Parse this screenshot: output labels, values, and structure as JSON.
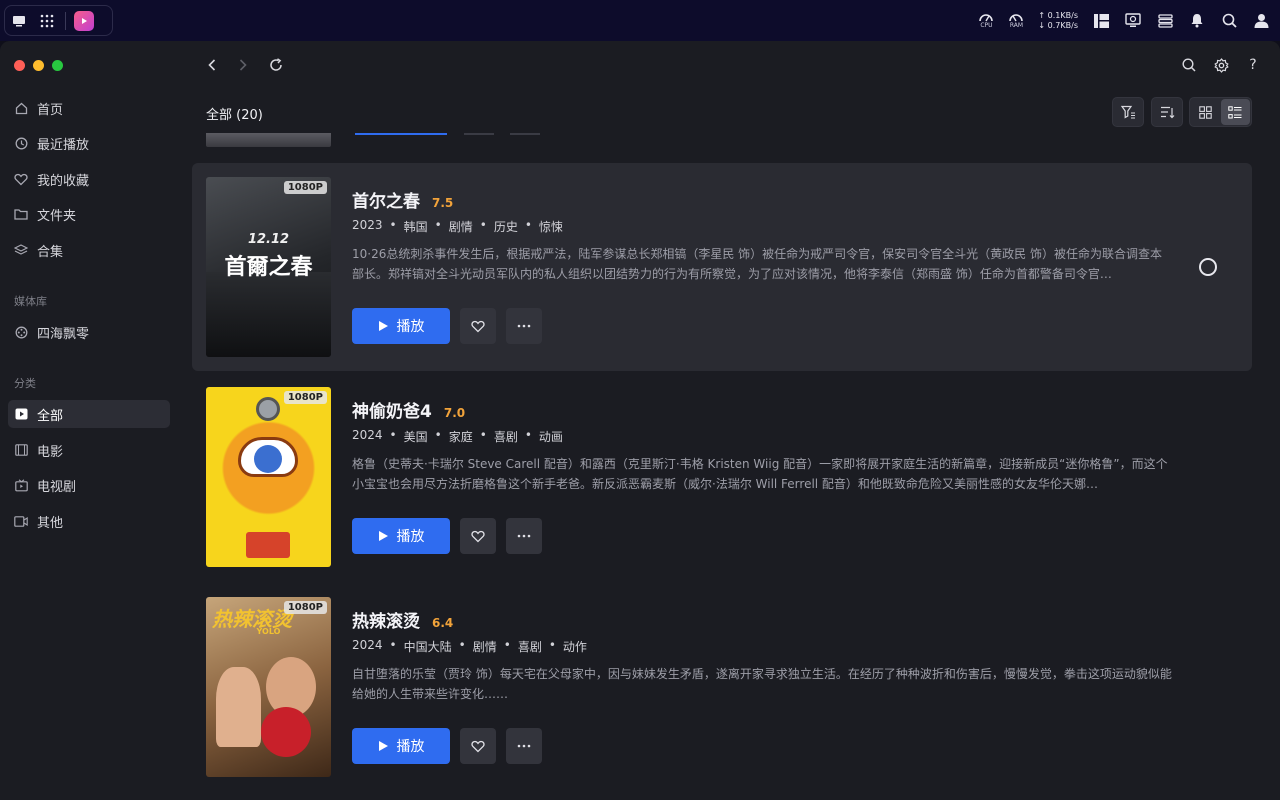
{
  "sysbar": {
    "cpu_label": "CPU",
    "ram_label": "RAM",
    "upload": "0.1KB/s",
    "download": "0.7KB/s"
  },
  "sidebar": {
    "items": [
      {
        "label": "首页",
        "icon": "home-icon"
      },
      {
        "label": "最近播放",
        "icon": "clock-icon"
      },
      {
        "label": "我的收藏",
        "icon": "heart-icon"
      },
      {
        "label": "文件夹",
        "icon": "folder-icon"
      },
      {
        "label": "合集",
        "icon": "layers-icon"
      }
    ],
    "library_section": "媒体库",
    "library_items": [
      {
        "label": "四海飘零",
        "icon": "film-reel-icon"
      }
    ],
    "category_section": "分类",
    "category_items": [
      {
        "label": "全部",
        "icon": "play-square-icon",
        "active": true
      },
      {
        "label": "电影",
        "icon": "film-icon"
      },
      {
        "label": "电视剧",
        "icon": "tv-icon"
      },
      {
        "label": "其他",
        "icon": "video-icon"
      }
    ]
  },
  "main": {
    "count_title": "全部 (20)",
    "play_label": "播放",
    "items": [
      {
        "title": "首尔之春",
        "score": "7.5",
        "badge": "1080P",
        "meta": [
          "2023",
          "韩国",
          "剧情",
          "历史",
          "惊悚"
        ],
        "description": "10·26总统刺杀事件发生后，根据戒严法，陆军参谋总长郑相镐（李星民 饰）被任命为戒严司令官，保安司令官全斗光（黄政民 饰）被任命为联合调查本部长。郑祥镐对全斗光动员军队内的私人组织以团结势力的行为有所察觉，为了应对该情况，他将李泰信（郑雨盛 饰）任命为首都警备司令官…",
        "poster_text": "首爾之春",
        "poster_sub": "12.12",
        "poster_colors": [
          "#3a3d40",
          "#15171a"
        ],
        "hover": true
      },
      {
        "title": "神偷奶爸4",
        "score": "7.0",
        "badge": "1080P",
        "meta": [
          "2024",
          "美国",
          "家庭",
          "喜剧",
          "动画"
        ],
        "description": "格鲁（史蒂夫·卡瑞尔 Steve Carell 配音）和露西（克里斯汀·韦格 Kristen Wiig 配音）一家即将展开家庭生活的新篇章，迎接新成员“迷你格鲁”，而这个小宝宝也会用尽方法折磨格鲁这个新手老爸。新反派恶霸麦斯（威尔·法瑞尔 Will Ferrell 配音）和他既致命危险又美丽性感的女友华伦天娜…",
        "poster_text": "",
        "poster_sub": "",
        "poster_colors": [
          "#f7d51c",
          "#f3b000"
        ],
        "hover": false
      },
      {
        "title": "热辣滚烫",
        "score": "6.4",
        "badge": "1080P",
        "meta": [
          "2024",
          "中国大陆",
          "剧情",
          "喜剧",
          "动作"
        ],
        "description": "自甘堕落的乐莹（贾玲 饰）每天宅在父母家中，因与妹妹发生矛盾，遂离开家寻求独立生活。在经历了种种波折和伤害后，慢慢发觉，拳击这项运动貌似能给她的人生带来些许变化……",
        "poster_text": "热辣滚烫",
        "poster_sub": "YOLO",
        "poster_colors": [
          "#b8905a",
          "#5a3a22"
        ],
        "hover": false
      }
    ]
  }
}
